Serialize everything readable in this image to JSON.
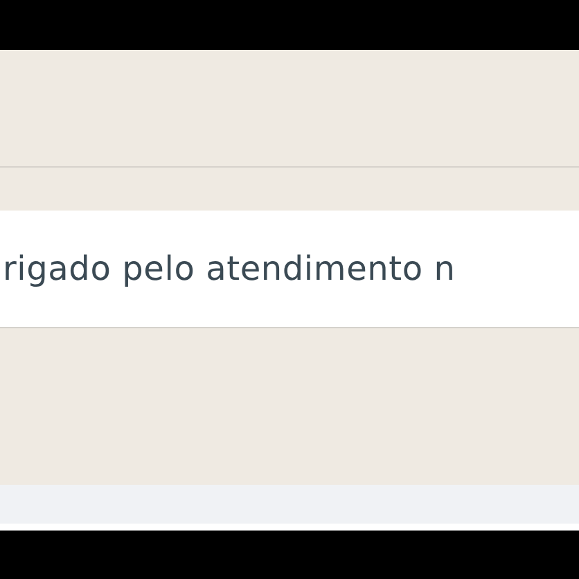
{
  "chat": {
    "messages": [
      {
        "text": "rigado pelo atendimento n"
      }
    ]
  }
}
